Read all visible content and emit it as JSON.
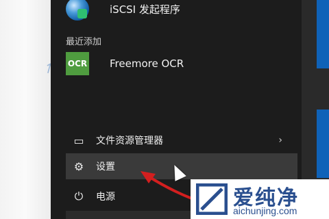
{
  "start_menu": {
    "top_app": {
      "label": "iSCSI 发起程序",
      "icon": "iscsi-globe-icon"
    },
    "recent_section": {
      "label": "最近添加"
    },
    "recent_app": {
      "label": "Freemore OCR",
      "icon_text": "OCR"
    },
    "items": [
      {
        "label": "文件资源管理器",
        "icon": "folder-icon",
        "chevron": "›"
      },
      {
        "label": "设置",
        "icon": "gear-icon"
      },
      {
        "label": "电源",
        "icon": "power-icon"
      }
    ]
  },
  "watermark": {
    "brand_cn": "爱纯净",
    "url": "aichunjing.com"
  },
  "colors": {
    "menu_bg": "#1c1c1c",
    "hover_bg": "#3a3a3a",
    "brand_blue": "#2a4f8f",
    "arrow_red": "#d31f1f"
  }
}
